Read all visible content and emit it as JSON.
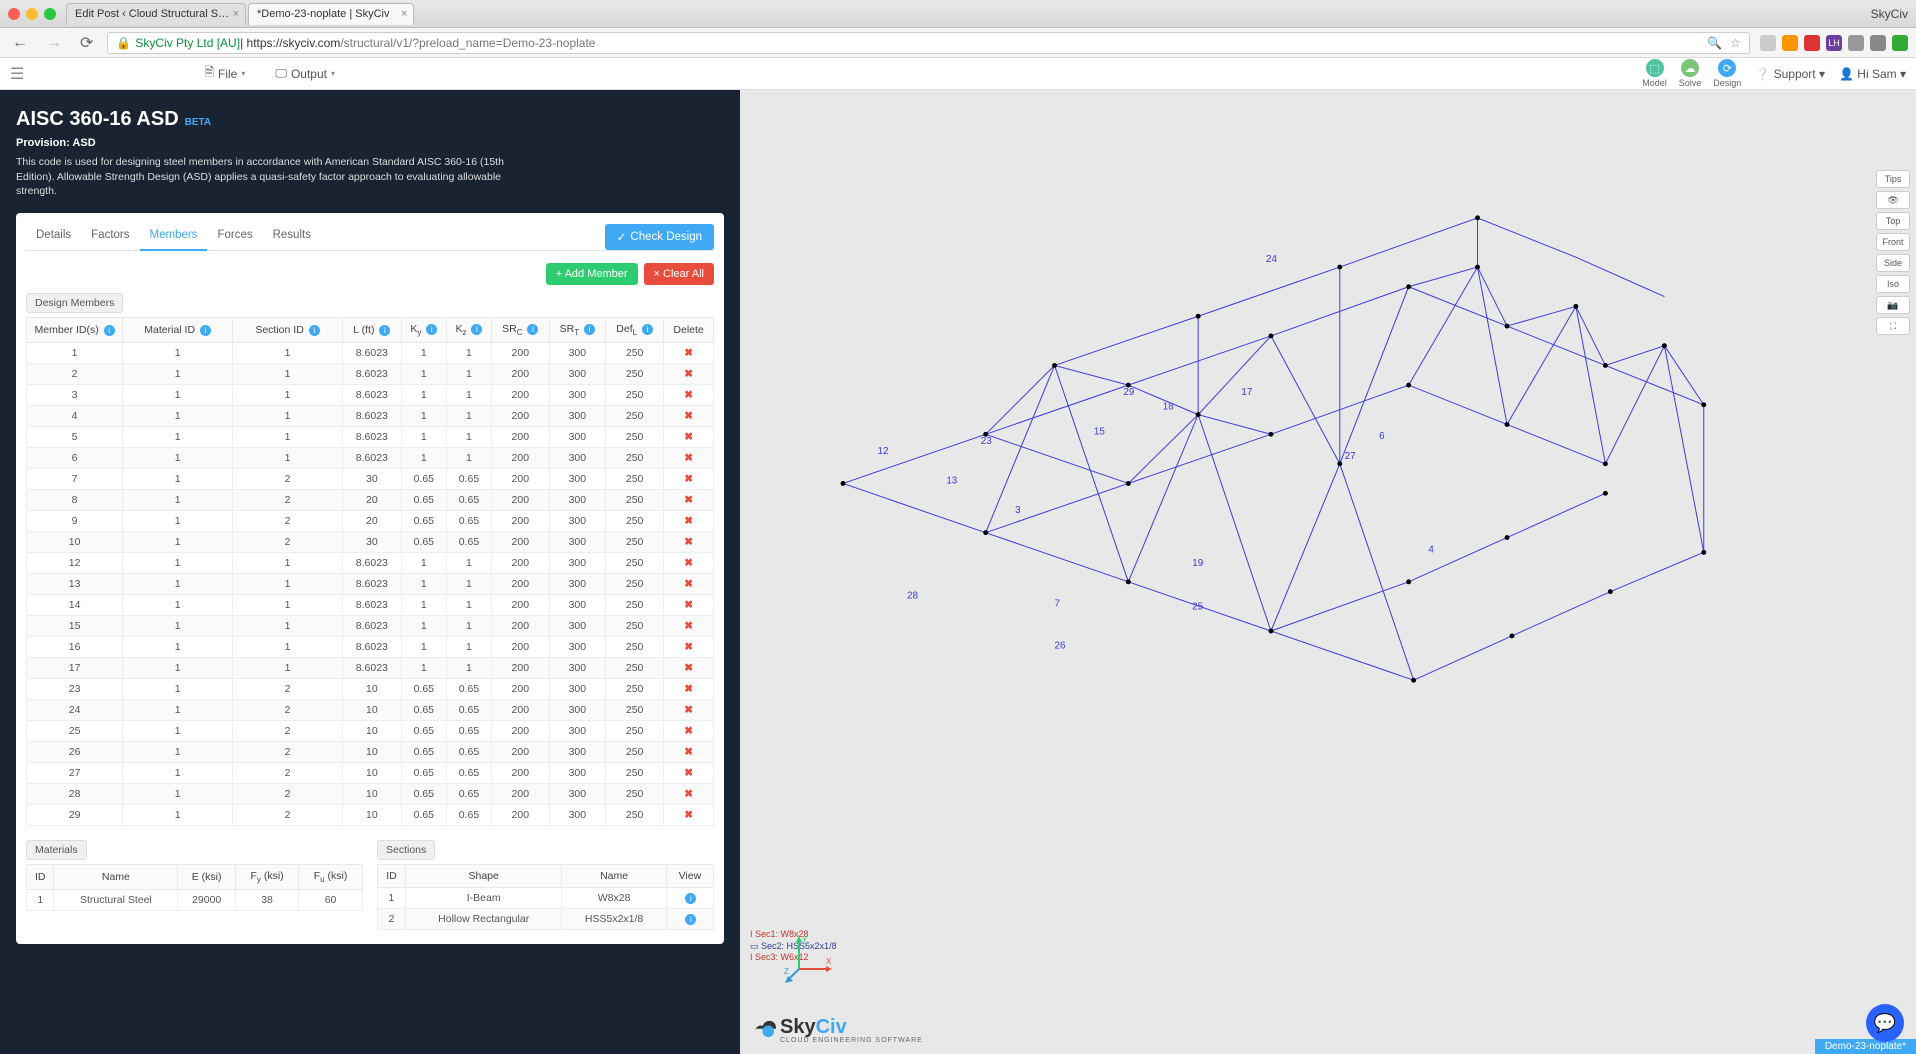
{
  "chrome": {
    "appName": "SkyCiv",
    "tabs": [
      {
        "title": "Edit Post ‹ Cloud Structural S…"
      },
      {
        "title": "*Demo-23-noplate | SkyCiv"
      }
    ],
    "urlOwner": "SkyCiv Pty Ltd [AU]",
    "urlHost": " | https://skyciv.com",
    "urlPath": "/structural/v1/?preload_name=Demo-23-noplate"
  },
  "toolbar": {
    "file": "File",
    "output": "Output",
    "modes": {
      "model": "Model",
      "solve": "Solve",
      "design": "Design"
    },
    "support": "Support",
    "user": "Hi Sam"
  },
  "panel": {
    "title": "AISC 360-16 ASD",
    "beta": "BETA",
    "provision": "Provision: ASD",
    "desc": "This code is used for designing steel members in accordance with American Standard AISC 360-16 (15th Edition). Allowable Strength Design (ASD) applies a quasi-safety factor approach to evaluating allowable strength.",
    "tabs": [
      "Details",
      "Factors",
      "Members",
      "Forces",
      "Results"
    ],
    "activeTab": 2,
    "checkDesign": "Check Design",
    "addMember": "Add Member",
    "clearAll": "Clear All",
    "designMembers": "Design Members",
    "headers": {
      "mid": "Member ID(s)",
      "mat": "Material ID",
      "sec": "Section ID",
      "l": "L (ft)",
      "ky": "K",
      "kz": "K",
      "src": "SR",
      "srt": "SR",
      "defl": "Def",
      "del": "Delete"
    }
  },
  "rows": [
    {
      "id": "1",
      "mat": "1",
      "sec": "1",
      "l": "8.6023",
      "ky": "1",
      "kz": "1",
      "src": "200",
      "srt": "300",
      "defl": "250"
    },
    {
      "id": "2",
      "mat": "1",
      "sec": "1",
      "l": "8.6023",
      "ky": "1",
      "kz": "1",
      "src": "200",
      "srt": "300",
      "defl": "250"
    },
    {
      "id": "3",
      "mat": "1",
      "sec": "1",
      "l": "8.6023",
      "ky": "1",
      "kz": "1",
      "src": "200",
      "srt": "300",
      "defl": "250"
    },
    {
      "id": "4",
      "mat": "1",
      "sec": "1",
      "l": "8.6023",
      "ky": "1",
      "kz": "1",
      "src": "200",
      "srt": "300",
      "defl": "250"
    },
    {
      "id": "5",
      "mat": "1",
      "sec": "1",
      "l": "8.6023",
      "ky": "1",
      "kz": "1",
      "src": "200",
      "srt": "300",
      "defl": "250"
    },
    {
      "id": "6",
      "mat": "1",
      "sec": "1",
      "l": "8.6023",
      "ky": "1",
      "kz": "1",
      "src": "200",
      "srt": "300",
      "defl": "250"
    },
    {
      "id": "7",
      "mat": "1",
      "sec": "2",
      "l": "30",
      "ky": "0.65",
      "kz": "0.65",
      "src": "200",
      "srt": "300",
      "defl": "250"
    },
    {
      "id": "8",
      "mat": "1",
      "sec": "2",
      "l": "20",
      "ky": "0.65",
      "kz": "0.65",
      "src": "200",
      "srt": "300",
      "defl": "250"
    },
    {
      "id": "9",
      "mat": "1",
      "sec": "2",
      "l": "20",
      "ky": "0.65",
      "kz": "0.65",
      "src": "200",
      "srt": "300",
      "defl": "250"
    },
    {
      "id": "10",
      "mat": "1",
      "sec": "2",
      "l": "30",
      "ky": "0.65",
      "kz": "0.65",
      "src": "200",
      "srt": "300",
      "defl": "250"
    },
    {
      "id": "12",
      "mat": "1",
      "sec": "1",
      "l": "8.6023",
      "ky": "1",
      "kz": "1",
      "src": "200",
      "srt": "300",
      "defl": "250"
    },
    {
      "id": "13",
      "mat": "1",
      "sec": "1",
      "l": "8.6023",
      "ky": "1",
      "kz": "1",
      "src": "200",
      "srt": "300",
      "defl": "250"
    },
    {
      "id": "14",
      "mat": "1",
      "sec": "1",
      "l": "8.6023",
      "ky": "1",
      "kz": "1",
      "src": "200",
      "srt": "300",
      "defl": "250"
    },
    {
      "id": "15",
      "mat": "1",
      "sec": "1",
      "l": "8.6023",
      "ky": "1",
      "kz": "1",
      "src": "200",
      "srt": "300",
      "defl": "250"
    },
    {
      "id": "16",
      "mat": "1",
      "sec": "1",
      "l": "8.6023",
      "ky": "1",
      "kz": "1",
      "src": "200",
      "srt": "300",
      "defl": "250"
    },
    {
      "id": "17",
      "mat": "1",
      "sec": "1",
      "l": "8.6023",
      "ky": "1",
      "kz": "1",
      "src": "200",
      "srt": "300",
      "defl": "250"
    },
    {
      "id": "23",
      "mat": "1",
      "sec": "2",
      "l": "10",
      "ky": "0.65",
      "kz": "0.65",
      "src": "200",
      "srt": "300",
      "defl": "250"
    },
    {
      "id": "24",
      "mat": "1",
      "sec": "2",
      "l": "10",
      "ky": "0.65",
      "kz": "0.65",
      "src": "200",
      "srt": "300",
      "defl": "250"
    },
    {
      "id": "25",
      "mat": "1",
      "sec": "2",
      "l": "10",
      "ky": "0.65",
      "kz": "0.65",
      "src": "200",
      "srt": "300",
      "defl": "250"
    },
    {
      "id": "26",
      "mat": "1",
      "sec": "2",
      "l": "10",
      "ky": "0.65",
      "kz": "0.65",
      "src": "200",
      "srt": "300",
      "defl": "250"
    },
    {
      "id": "27",
      "mat": "1",
      "sec": "2",
      "l": "10",
      "ky": "0.65",
      "kz": "0.65",
      "src": "200",
      "srt": "300",
      "defl": "250"
    },
    {
      "id": "28",
      "mat": "1",
      "sec": "2",
      "l": "10",
      "ky": "0.65",
      "kz": "0.65",
      "src": "200",
      "srt": "300",
      "defl": "250"
    },
    {
      "id": "29",
      "mat": "1",
      "sec": "2",
      "l": "10",
      "ky": "0.65",
      "kz": "0.65",
      "src": "200",
      "srt": "300",
      "defl": "250"
    }
  ],
  "materials": {
    "tag": "Materials",
    "headers": [
      "ID",
      "Name",
      "E (ksi)",
      "F",
      "F"
    ],
    "row": {
      "id": "1",
      "name": "Structural Steel",
      "e": "29000",
      "fy": "38",
      "fu": "60"
    }
  },
  "sections": {
    "tag": "Sections",
    "headers": [
      "ID",
      "Shape",
      "Name",
      "View"
    ],
    "rows": [
      {
        "id": "1",
        "shape": "I-Beam",
        "name": "W8x28"
      },
      {
        "id": "2",
        "shape": "Hollow Rectangular",
        "name": "HSS5x2x1/8"
      }
    ]
  },
  "legend": {
    "s1": "Sec1: W8x28",
    "s2": "Sec2: HSS5x2x1/8",
    "s3": "Sec3: W6x12"
  },
  "sideButtons": [
    "Tips",
    "👁",
    "Top",
    "Front",
    "Side",
    "Iso",
    "📷",
    "⛶"
  ],
  "status": "Demo-23-noplate*",
  "logo": {
    "brand": "SkyCiv",
    "sub": "CLOUD ENGINEERING SOFTWARE"
  },
  "truss": {
    "labels": [
      "12",
      "13",
      "23",
      "29",
      "15",
      "18",
      "7",
      "26",
      "3",
      "4",
      "17",
      "24",
      "6",
      "27",
      "25",
      "19",
      "28"
    ]
  }
}
